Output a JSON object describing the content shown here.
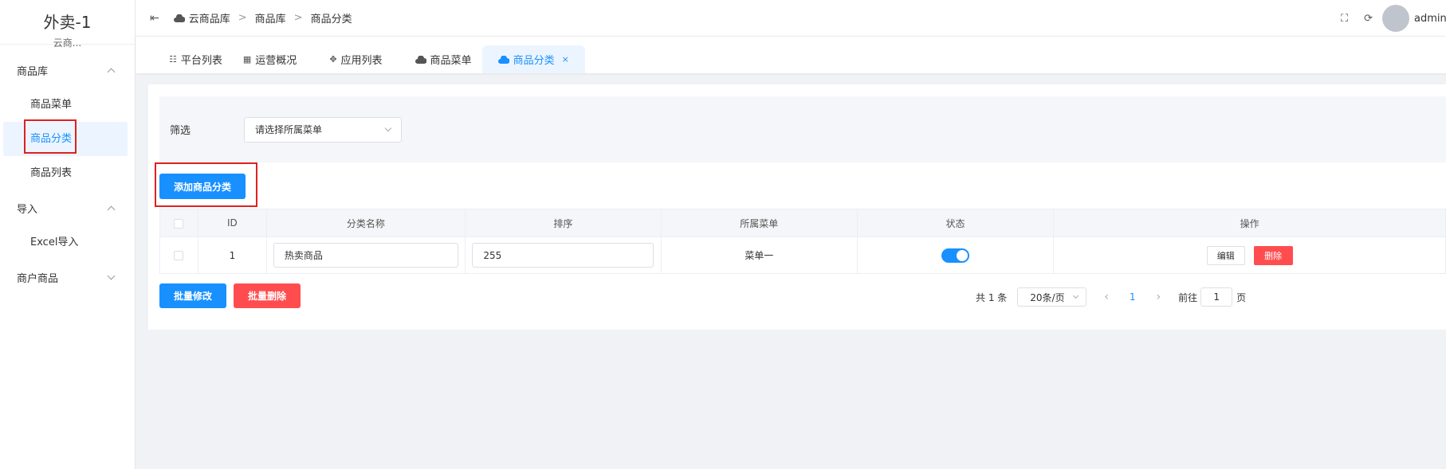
{
  "brand": {
    "title": "外卖-1",
    "subtitle": "云商..."
  },
  "sidebar": {
    "groups": [
      {
        "label": "商品库",
        "items": [
          "商品菜单",
          "商品分类",
          "商品列表"
        ]
      },
      {
        "label": "导入",
        "items": [
          "Excel导入"
        ]
      },
      {
        "label": "商户商品",
        "items": []
      }
    ],
    "active_item": "商品分类"
  },
  "header": {
    "breadcrumb": [
      "云商品库",
      "商品库",
      "商品分类"
    ],
    "breadcrumb_separator": ">",
    "user": "admin"
  },
  "tabs": [
    {
      "label": "平台列表",
      "icon": "list-icon"
    },
    {
      "label": "运营概况",
      "icon": "grid-icon"
    },
    {
      "label": "应用列表",
      "icon": "apps-icon"
    },
    {
      "label": "商品菜单",
      "icon": "cloud-icon"
    },
    {
      "label": "商品分类",
      "icon": "cloud-icon",
      "active": true,
      "close": "×"
    }
  ],
  "filter": {
    "label": "筛选",
    "select_placeholder": "请选择所属菜单"
  },
  "buttons": {
    "add": "添加商品分类",
    "batch_edit": "批量修改",
    "batch_delete": "批量删除"
  },
  "table": {
    "columns": [
      "ID",
      "分类名称",
      "排序",
      "所属菜单",
      "状态",
      "操作"
    ],
    "rows": [
      {
        "id": "1",
        "name": "热卖商品",
        "sort": "255",
        "menu": "菜单一",
        "status": true,
        "edit": "编辑",
        "delete": "删除"
      }
    ]
  },
  "pagination": {
    "total": "共 1 条",
    "page_size": "20条/页",
    "current": "1",
    "goto_label": "前往",
    "goto_value": "1",
    "page_unit": "页"
  },
  "colors": {
    "primary": "#1890ff",
    "danger": "#ff4d4f",
    "highlight": "#e02020"
  }
}
